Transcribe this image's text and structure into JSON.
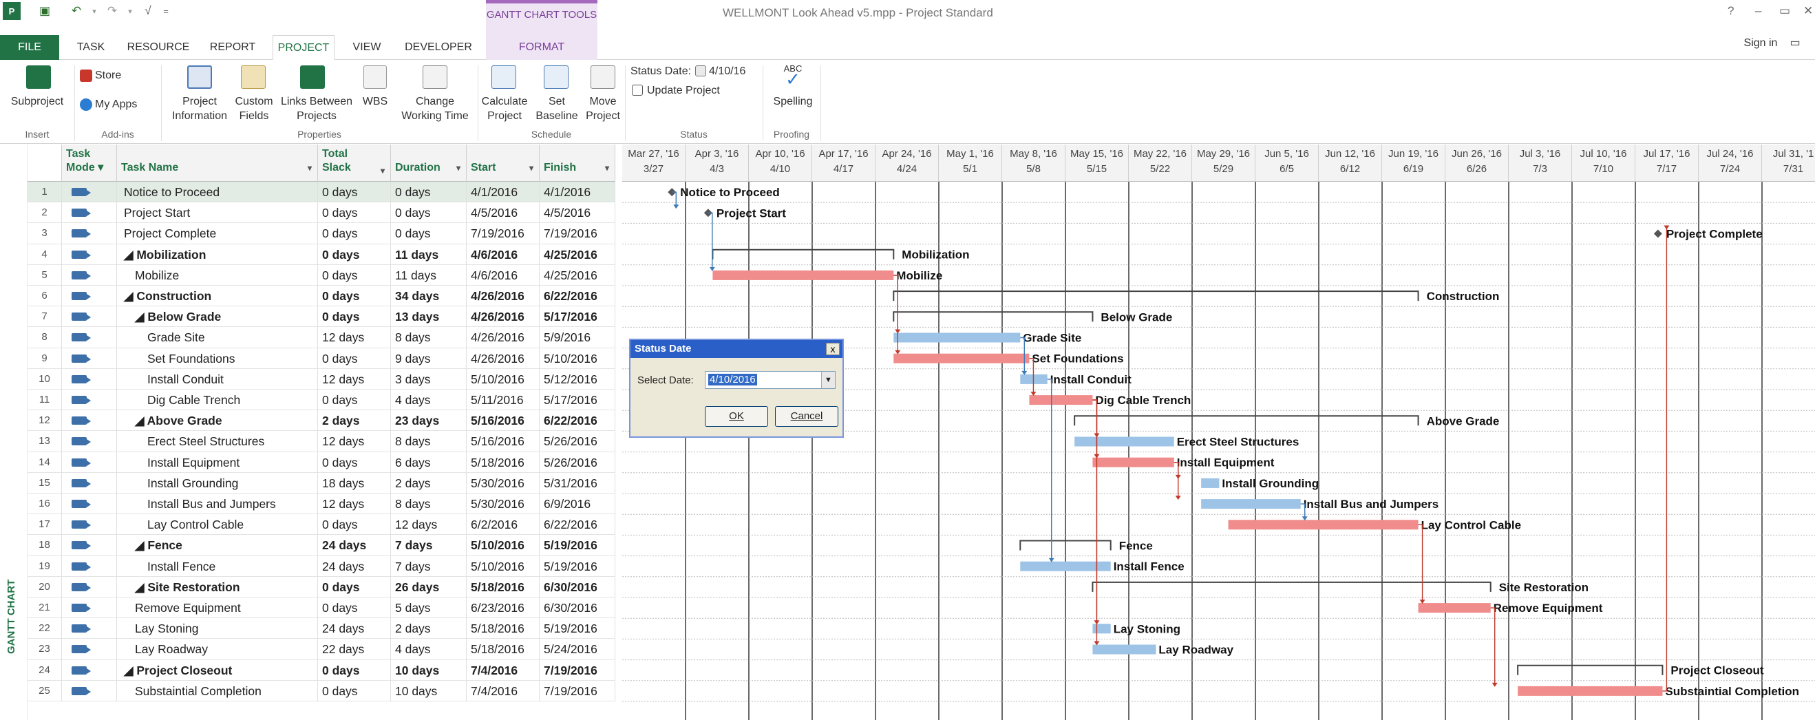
{
  "window": {
    "title": "WELLMONT Look Ahead v5.mpp - Project Standard",
    "context_tab_group": "GANTT CHART TOOLS",
    "help": "?",
    "sign_in": "Sign in"
  },
  "tabs": [
    "FILE",
    "TASK",
    "RESOURCE",
    "REPORT",
    "PROJECT",
    "VIEW",
    "DEVELOPER",
    "FORMAT"
  ],
  "active_tab": "PROJECT",
  "ribbon": {
    "subproject": "Subproject",
    "store": "Store",
    "my_apps": "My Apps",
    "project_information_1": "Project",
    "project_information_2": "Information",
    "custom_fields_1": "Custom",
    "custom_fields_2": "Fields",
    "links_between_1": "Links Between",
    "links_between_2": "Projects",
    "wbs": "WBS",
    "change_wt_1": "Change",
    "change_wt_2": "Working Time",
    "calculate_1": "Calculate",
    "calculate_2": "Project",
    "set_baseline_1": "Set",
    "set_baseline_2": "Baseline",
    "move_1": "Move",
    "move_2": "Project",
    "status_date_label": "Status Date:",
    "status_date_value": "4/10/16",
    "update_project": "Update Project",
    "abc": "ABC",
    "spelling": "Spelling",
    "groups": [
      "Insert",
      "Add-ins",
      "Properties",
      "Schedule",
      "Status",
      "Proofing"
    ]
  },
  "sidebar_label": "GANTT CHART",
  "columns": {
    "mode_1": "Task",
    "mode_2": "Mode",
    "name": "Task Name",
    "slack_1": "Total",
    "slack_2": "Slack",
    "duration": "Duration",
    "start": "Start",
    "finish": "Finish"
  },
  "tasks": [
    {
      "id": "1",
      "name": "Notice to Proceed",
      "slack": "0 days",
      "duration": "0 days",
      "start": "4/1/2016",
      "finish": "4/1/2016"
    },
    {
      "id": "2",
      "name": "Project Start",
      "slack": "0 days",
      "duration": "0 days",
      "start": "4/5/2016",
      "finish": "4/5/2016"
    },
    {
      "id": "3",
      "name": "Project Complete",
      "slack": "0 days",
      "duration": "0 days",
      "start": "7/19/2016",
      "finish": "7/19/2016"
    },
    {
      "id": "4",
      "name": "◢ Mobilization",
      "slack": "0 days",
      "duration": "11 days",
      "start": "4/6/2016",
      "finish": "4/25/2016"
    },
    {
      "id": "5",
      "name": "Mobilize",
      "slack": "0 days",
      "duration": "11 days",
      "start": "4/6/2016",
      "finish": "4/25/2016"
    },
    {
      "id": "6",
      "name": "◢ Construction",
      "slack": "0 days",
      "duration": "34 days",
      "start": "4/26/2016",
      "finish": "6/22/2016"
    },
    {
      "id": "7",
      "name": "◢ Below Grade",
      "slack": "0 days",
      "duration": "13 days",
      "start": "4/26/2016",
      "finish": "5/17/2016"
    },
    {
      "id": "8",
      "name": "Grade Site",
      "slack": "12 days",
      "duration": "8 days",
      "start": "4/26/2016",
      "finish": "5/9/2016"
    },
    {
      "id": "9",
      "name": "Set Foundations",
      "slack": "0 days",
      "duration": "9 days",
      "start": "4/26/2016",
      "finish": "5/10/2016"
    },
    {
      "id": "10",
      "name": "Install Conduit",
      "slack": "12 days",
      "duration": "3 days",
      "start": "5/10/2016",
      "finish": "5/12/2016"
    },
    {
      "id": "11",
      "name": "Dig Cable Trench",
      "slack": "0 days",
      "duration": "4 days",
      "start": "5/11/2016",
      "finish": "5/17/2016"
    },
    {
      "id": "12",
      "name": "◢ Above Grade",
      "slack": "2 days",
      "duration": "23 days",
      "start": "5/16/2016",
      "finish": "6/22/2016"
    },
    {
      "id": "13",
      "name": "Erect Steel Structures",
      "slack": "12 days",
      "duration": "8 days",
      "start": "5/16/2016",
      "finish": "5/26/2016"
    },
    {
      "id": "14",
      "name": "Install Equipment",
      "slack": "0 days",
      "duration": "6 days",
      "start": "5/18/2016",
      "finish": "5/26/2016"
    },
    {
      "id": "15",
      "name": "Install Grounding",
      "slack": "18 days",
      "duration": "2 days",
      "start": "5/30/2016",
      "finish": "5/31/2016"
    },
    {
      "id": "16",
      "name": "Install Bus and Jumpers",
      "slack": "12 days",
      "duration": "8 days",
      "start": "5/30/2016",
      "finish": "6/9/2016"
    },
    {
      "id": "17",
      "name": "Lay Control Cable",
      "slack": "0 days",
      "duration": "12 days",
      "start": "6/2/2016",
      "finish": "6/22/2016"
    },
    {
      "id": "18",
      "name": "◢ Fence",
      "slack": "24 days",
      "duration": "7 days",
      "start": "5/10/2016",
      "finish": "5/19/2016"
    },
    {
      "id": "19",
      "name": "Install Fence",
      "slack": "24 days",
      "duration": "7 days",
      "start": "5/10/2016",
      "finish": "5/19/2016"
    },
    {
      "id": "20",
      "name": "◢ Site Restoration",
      "slack": "0 days",
      "duration": "26 days",
      "start": "5/18/2016",
      "finish": "6/30/2016"
    },
    {
      "id": "21",
      "name": "Remove Equipment",
      "slack": "0 days",
      "duration": "5 days",
      "start": "6/23/2016",
      "finish": "6/30/2016"
    },
    {
      "id": "22",
      "name": "Lay Stoning",
      "slack": "24 days",
      "duration": "2 days",
      "start": "5/18/2016",
      "finish": "5/19/2016"
    },
    {
      "id": "23",
      "name": "Lay Roadway",
      "slack": "22 days",
      "duration": "4 days",
      "start": "5/18/2016",
      "finish": "5/24/2016"
    },
    {
      "id": "24",
      "name": "◢ Project Closeout",
      "slack": "0 days",
      "duration": "10 days",
      "start": "7/4/2016",
      "finish": "7/19/2016"
    },
    {
      "id": "25",
      "name": "Substaintial Completion",
      "slack": "0 days",
      "duration": "10 days",
      "start": "7/4/2016",
      "finish": "7/19/2016"
    }
  ],
  "timescale": [
    {
      "top": "Mar 27, '16",
      "bottom": "3/27"
    },
    {
      "top": "Apr 3, '16",
      "bottom": "4/3"
    },
    {
      "top": "Apr 10, '16",
      "bottom": "4/10"
    },
    {
      "top": "Apr 17, '16",
      "bottom": "4/17"
    },
    {
      "top": "Apr 24, '16",
      "bottom": "4/24"
    },
    {
      "top": "May 1, '16",
      "bottom": "5/1"
    },
    {
      "top": "May 8, '16",
      "bottom": "5/8"
    },
    {
      "top": "May 15, '16",
      "bottom": "5/15"
    },
    {
      "top": "May 22, '16",
      "bottom": "5/22"
    },
    {
      "top": "May 29, '16",
      "bottom": "5/29"
    },
    {
      "top": "Jun 5, '16",
      "bottom": "6/5"
    },
    {
      "top": "Jun 12, '16",
      "bottom": "6/12"
    },
    {
      "top": "Jun 19, '16",
      "bottom": "6/19"
    },
    {
      "top": "Jun 26, '16",
      "bottom": "6/26"
    },
    {
      "top": "Jul 3, '16",
      "bottom": "7/3"
    },
    {
      "top": "Jul 10, '16",
      "bottom": "7/10"
    },
    {
      "top": "Jul 17, '16",
      "bottom": "7/17"
    },
    {
      "top": "Jul 24, '16",
      "bottom": "7/24"
    },
    {
      "top": "Jul 31, '1",
      "bottom": "7/31"
    }
  ],
  "gantt_labels": [
    "Notice to Proceed",
    "Project Start",
    "Project Complete",
    "Mobilization",
    "Mobilize",
    "Construction",
    "Below Grade",
    "Grade Site",
    "Set Foundations",
    "Install Conduit",
    "Dig Cable Trench",
    "Above Grade",
    "Erect Steel Structures",
    "Install Equipment",
    "Install Grounding",
    "Install Bus and Jumpers",
    "Lay Control Cable",
    "Fence",
    "Install Fence",
    "Site Restoration",
    "Remove Equipment",
    "Lay Stoning",
    "Lay Roadway",
    "Project Closeout",
    "Substaintial Completion"
  ],
  "dialog": {
    "title": "Status Date",
    "close": "x",
    "label": "Select Date:",
    "value": "4/10/2016",
    "ok": "OK",
    "cancel": "Cancel"
  },
  "colors": {
    "critical": "#f08c8c",
    "noncritical": "#9dc3e6",
    "accent": "#217346"
  }
}
